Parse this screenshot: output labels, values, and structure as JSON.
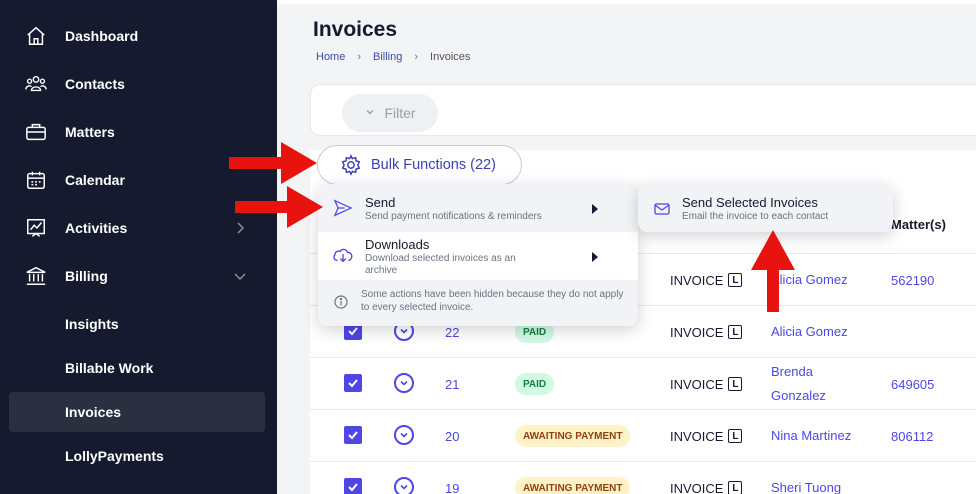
{
  "sidebar": {
    "items": [
      {
        "label": "Dashboard",
        "icon": "home-icon"
      },
      {
        "label": "Contacts",
        "icon": "users-icon"
      },
      {
        "label": "Matters",
        "icon": "briefcase-icon"
      },
      {
        "label": "Calendar",
        "icon": "calendar-icon"
      },
      {
        "label": "Activities",
        "icon": "chart-icon"
      },
      {
        "label": "Billing",
        "icon": "bank-icon"
      }
    ],
    "billing_sub": [
      {
        "label": "Insights"
      },
      {
        "label": "Billable Work"
      },
      {
        "label": "Invoices"
      },
      {
        "label": "LollyPayments"
      }
    ]
  },
  "page": {
    "title": "Invoices",
    "breadcrumb": [
      "Home",
      "Billing",
      "Invoices"
    ]
  },
  "toolbar": {
    "filter_label": "Filter",
    "bulk_label": "Bulk Functions (22)"
  },
  "menu": {
    "send_title": "Send",
    "send_sub": "Send payment notifications & reminders",
    "downloads_title": "Downloads",
    "downloads_sub": "Download selected invoices as an archive",
    "note": "Some actions have been hidden because they do not apply to every selected invoice."
  },
  "submenu": {
    "title": "Send Selected Invoices",
    "sub": "Email the invoice to each contact"
  },
  "table": {
    "matters_header": "Matter(s)",
    "rows": [
      {
        "num": "",
        "status": "",
        "type": "INVOICE",
        "type_badge": "L",
        "contact": "Alicia Gomez",
        "matter": "562190"
      },
      {
        "num": "22",
        "status": "PAID",
        "type": "INVOICE",
        "type_badge": "L",
        "contact": "Alicia Gomez",
        "matter": ""
      },
      {
        "num": "21",
        "status": "PAID",
        "type": "INVOICE",
        "type_badge": "L",
        "contact": "Brenda Gonzalez",
        "matter": "649605"
      },
      {
        "num": "20",
        "status": "AWAITING PAYMENT",
        "type": "INVOICE",
        "type_badge": "L",
        "contact": "Nina Martinez",
        "matter": "806112"
      },
      {
        "num": "19",
        "status": "AWAITING PAYMENT",
        "type": "INVOICE",
        "type_badge": "L",
        "contact": "Sheri Tuong",
        "matter": ""
      }
    ]
  },
  "colors": {
    "sidebar_bg": "#151a2e",
    "accent": "#4f46e5",
    "annotation_red": "#e8120f"
  }
}
